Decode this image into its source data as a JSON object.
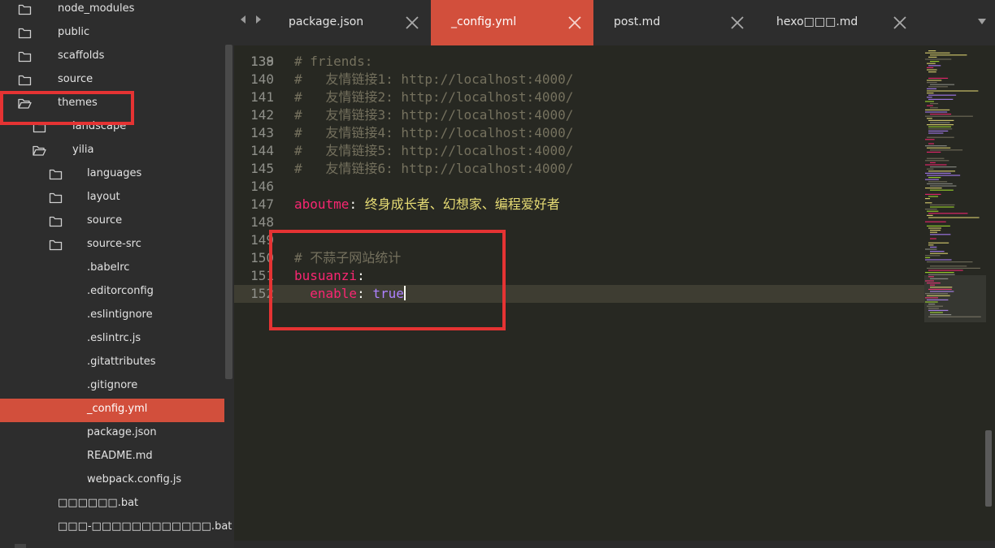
{
  "sidebar": {
    "items": [
      {
        "label": "node_modules",
        "icon": "folder-closed-icon"
      },
      {
        "label": "public",
        "icon": "folder-closed-icon"
      },
      {
        "label": "scaffolds",
        "icon": "folder-closed-icon"
      },
      {
        "label": "source",
        "icon": "folder-closed-icon"
      },
      {
        "label": "themes",
        "icon": "folder-open-icon"
      },
      {
        "label": "landscape",
        "icon": "folder-closed-icon"
      },
      {
        "label": "yilia",
        "icon": "folder-open-icon"
      },
      {
        "label": "languages",
        "icon": "folder-closed-icon"
      },
      {
        "label": "layout",
        "icon": "folder-closed-icon"
      },
      {
        "label": "source",
        "icon": "folder-closed-icon"
      },
      {
        "label": "source-src",
        "icon": "folder-closed-icon"
      },
      {
        "label": ".babelrc",
        "icon": ""
      },
      {
        "label": ".editorconfig",
        "icon": ""
      },
      {
        "label": ".eslintignore",
        "icon": ""
      },
      {
        "label": ".eslintrc.js",
        "icon": ""
      },
      {
        "label": ".gitattributes",
        "icon": ""
      },
      {
        "label": ".gitignore",
        "icon": ""
      },
      {
        "label": "_config.yml",
        "icon": "",
        "selected": true
      },
      {
        "label": "package.json",
        "icon": ""
      },
      {
        "label": "README.md",
        "icon": ""
      },
      {
        "label": "webpack.config.js",
        "icon": ""
      },
      {
        "label": "□□□□□□.bat",
        "icon": ""
      },
      {
        "label": "□□□-□□□□□□□□□□□□.bat",
        "icon": ""
      }
    ]
  },
  "tabs": [
    {
      "label": "package.json",
      "active": false
    },
    {
      "label": "_config.yml",
      "active": true
    },
    {
      "label": "post.md",
      "active": false
    },
    {
      "label": "hexo□□□.md",
      "active": false
    }
  ],
  "editor": {
    "file": "_config.yml",
    "lines": [
      {
        "num": "139",
        "comment": "# friends:"
      },
      {
        "num": "140",
        "comment": "#   友情链接1: http://localhost:4000/"
      },
      {
        "num": "141",
        "comment": "#   友情链接2: http://localhost:4000/"
      },
      {
        "num": "142",
        "comment": "#   友情链接3: http://localhost:4000/"
      },
      {
        "num": "143",
        "comment": "#   友情链接4: http://localhost:4000/"
      },
      {
        "num": "144",
        "comment": "#   友情链接5: http://localhost:4000/"
      },
      {
        "num": "145",
        "comment": "#   友情链接6: http://localhost:4000/"
      },
      {
        "num": "146"
      },
      {
        "num": "147",
        "key": "aboutme",
        "sep": ": ",
        "value": "终身成长者、幻想家、编程爱好者",
        "value_type": "string"
      },
      {
        "num": "148"
      },
      {
        "num": "149"
      },
      {
        "num": "150",
        "comment": "# 不蒜子网站统计"
      },
      {
        "num": "151",
        "key": "busuanzi",
        "sep": ":"
      },
      {
        "num": "152",
        "indent": "  ",
        "key": "enable",
        "sep": ": ",
        "value": "true",
        "value_type": "constant",
        "current": true
      }
    ]
  },
  "colors": {
    "accent": "#d24f3c",
    "annotation": "#e53333",
    "editor_bg": "#272822",
    "comment": "#75715e",
    "key": "#f92672",
    "string": "#e6db74",
    "constant": "#ae81ff"
  }
}
